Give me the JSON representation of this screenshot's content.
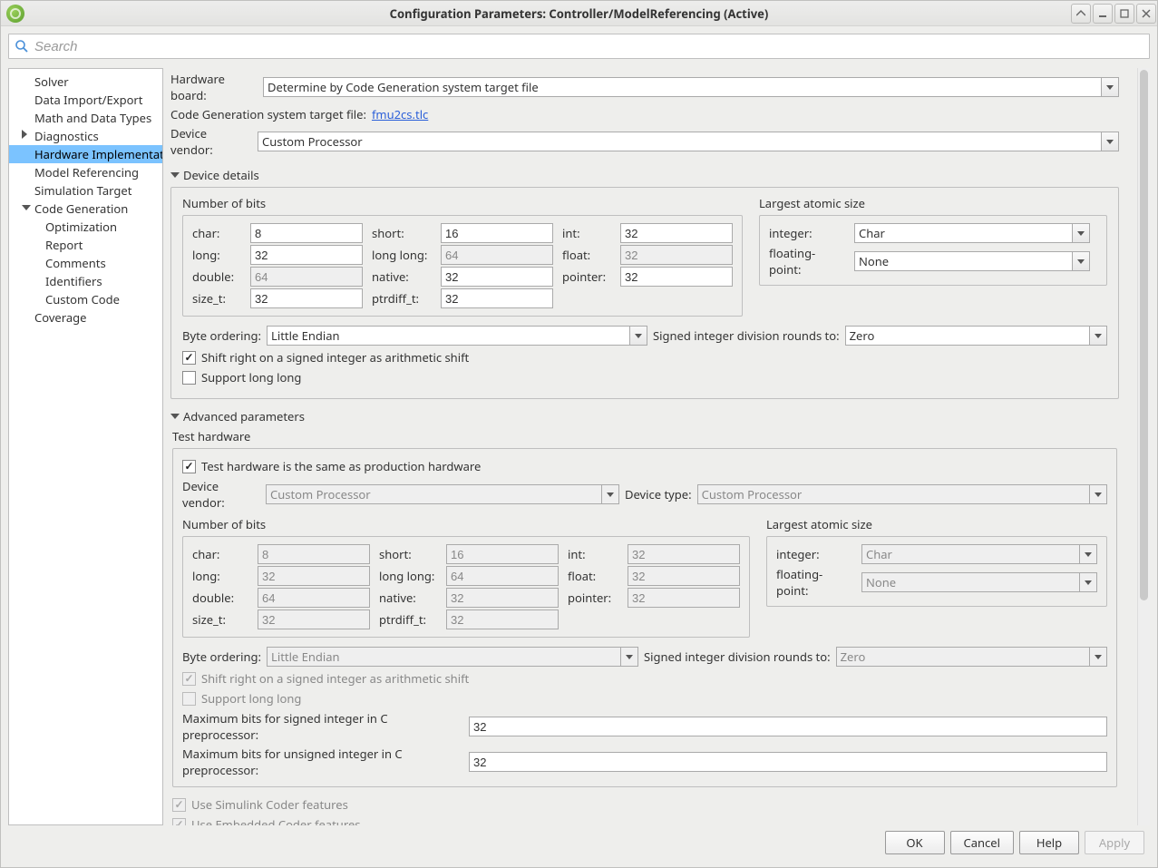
{
  "window": {
    "title": "Configuration Parameters: Controller/ModelReferencing (Active)"
  },
  "search": {
    "placeholder": "Search"
  },
  "tree": {
    "items": [
      {
        "label": "Solver"
      },
      {
        "label": "Data Import/Export"
      },
      {
        "label": "Math and Data Types"
      },
      {
        "label": "Diagnostics",
        "caret": "closed"
      },
      {
        "label": "Hardware Implementation",
        "selected": true
      },
      {
        "label": "Model Referencing"
      },
      {
        "label": "Simulation Target"
      },
      {
        "label": "Code Generation",
        "caret": "open"
      },
      {
        "label": "Optimization",
        "lvl": 2
      },
      {
        "label": "Report",
        "lvl": 2
      },
      {
        "label": "Comments",
        "lvl": 2
      },
      {
        "label": "Identifiers",
        "lvl": 2
      },
      {
        "label": "Custom Code",
        "lvl": 2
      },
      {
        "label": "Coverage"
      }
    ]
  },
  "labels": {
    "hw_board": "Hardware board:",
    "cg_target": "Code Generation system target file:",
    "dev_vendor": "Device vendor:",
    "device_details": "Device details",
    "num_bits": "Number of bits",
    "largest_atomic": "Largest atomic size",
    "char": "char:",
    "short": "short:",
    "int": "int:",
    "long": "long:",
    "long_long": "long long:",
    "float": "float:",
    "double": "double:",
    "native": "native:",
    "pointer": "pointer:",
    "size_t": "size_t:",
    "ptrdiff_t": "ptrdiff_t:",
    "integer": "integer:",
    "floating_point": "floating-point:",
    "byte_order": "Byte ordering:",
    "signed_div": "Signed integer division rounds to:",
    "shift_right": "Shift right on a signed integer as arithmetic shift",
    "support_ll": "Support long long",
    "adv_params": "Advanced parameters",
    "test_hw": "Test hardware",
    "test_same": "Test hardware is the same as production hardware",
    "dev_type": "Device type:",
    "max_signed": "Maximum bits for signed integer in C preprocessor:",
    "max_unsigned": "Maximum bits for unsigned integer in C preprocessor:",
    "use_simulink": "Use Simulink Coder features",
    "use_embedded": "Use Embedded Coder features"
  },
  "values": {
    "hw_board": "Determine by Code Generation system target file",
    "cg_target": "fmu2cs.tlc",
    "dev_vendor": "Custom Processor",
    "bits": {
      "char": "8",
      "short": "16",
      "int": "32",
      "long": "32",
      "long_long": "64",
      "float": "32",
      "double": "64",
      "native": "32",
      "pointer": "32",
      "size_t": "32",
      "ptrdiff_t": "32"
    },
    "atomic": {
      "integer": "Char",
      "floating_point": "None"
    },
    "byte_order": "Little Endian",
    "signed_div": "Zero",
    "shift_right": true,
    "support_ll": false,
    "test_same": true,
    "test_dev_vendor": "Custom Processor",
    "test_dev_type": "Custom Processor",
    "test_bits": {
      "char": "8",
      "short": "16",
      "int": "32",
      "long": "32",
      "long_long": "64",
      "float": "32",
      "double": "64",
      "native": "32",
      "pointer": "32",
      "size_t": "32",
      "ptrdiff_t": "32"
    },
    "test_atomic": {
      "integer": "Char",
      "floating_point": "None"
    },
    "test_byte_order": "Little Endian",
    "test_signed_div": "Zero",
    "test_shift_right": true,
    "test_support_ll": false,
    "max_signed": "32",
    "max_unsigned": "32",
    "use_simulink": true,
    "use_embedded": true
  },
  "buttons": {
    "ok": "OK",
    "cancel": "Cancel",
    "help": "Help",
    "apply": "Apply"
  }
}
